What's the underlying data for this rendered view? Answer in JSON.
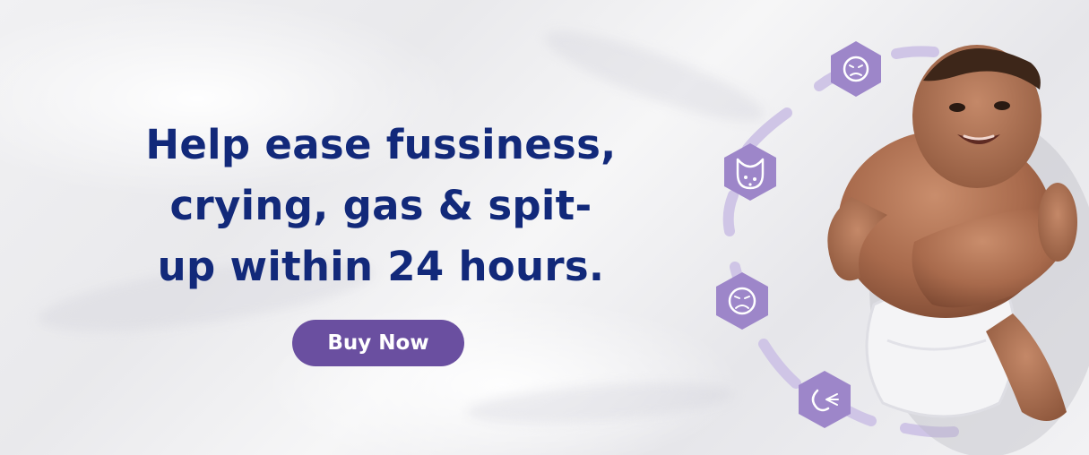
{
  "banner": {
    "headline": "Help ease fussiness, crying, gas & spit-up within 24 hours.",
    "cta_label": "Buy Now"
  },
  "colors": {
    "headline": "#12297a",
    "button": "#6a4fa0",
    "icon_fill": "#9d86c9",
    "arc": "#cfc5e6"
  },
  "icons": [
    "fussy-face-icon",
    "spit-up-bib-icon",
    "crying-face-icon",
    "gas-icon"
  ]
}
